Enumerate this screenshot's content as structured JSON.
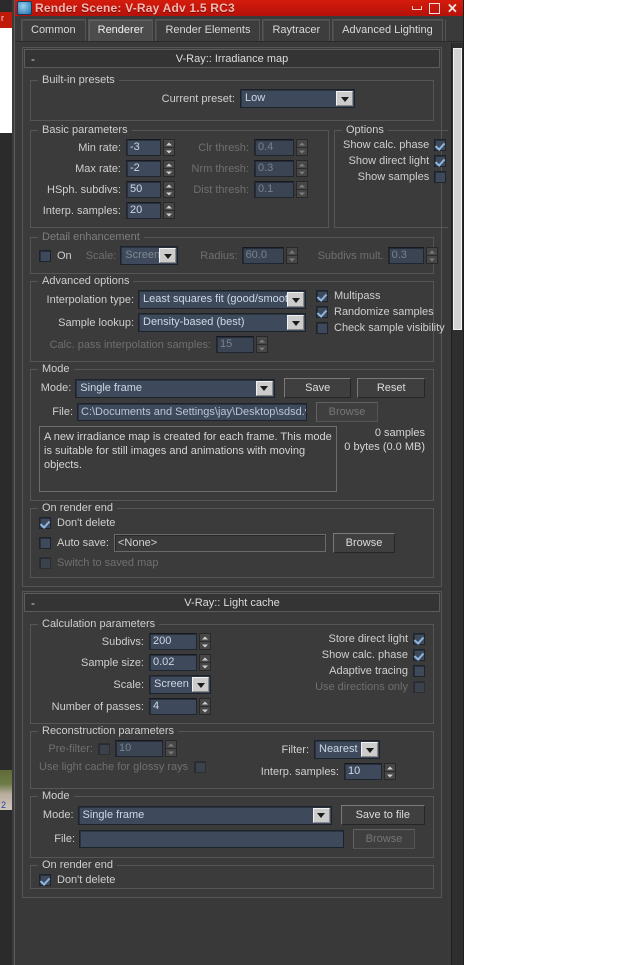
{
  "window": {
    "title": "Render Scene: V-Ray Adv 1.5 RC3",
    "app_icon": "render-scene-icon",
    "minimize": "minimize-icon",
    "maximize": "maximize-icon",
    "close": "close-icon"
  },
  "tabs": [
    {
      "label": "Common",
      "active": false
    },
    {
      "label": "Renderer",
      "active": true
    },
    {
      "label": "Render Elements",
      "active": false
    },
    {
      "label": "Raytracer",
      "active": false
    },
    {
      "label": "Advanced Lighting",
      "active": false
    }
  ],
  "irradiance_map": {
    "rollout_title": "V-Ray:: Irradiance map",
    "collapse_glyph": "-",
    "builtin_presets": {
      "legend": "Built-in presets",
      "current_preset_label": "Current preset:",
      "current_preset_value": "Low"
    },
    "basic_parameters": {
      "legend": "Basic parameters",
      "min_rate_label": "Min rate:",
      "min_rate_value": "-3",
      "max_rate_label": "Max rate:",
      "max_rate_value": "-2",
      "hsph_subdivs_label": "HSph. subdivs:",
      "hsph_subdivs_value": "50",
      "interp_samples_label": "Interp. samples:",
      "interp_samples_value": "20",
      "clr_thresh_label": "Clr thresh:",
      "clr_thresh_value": "0.4",
      "nrm_thresh_label": "Nrm thresh:",
      "nrm_thresh_value": "0.3",
      "dist_thresh_label": "Dist thresh:",
      "dist_thresh_value": "0.1"
    },
    "options": {
      "legend": "Options",
      "show_calc_phase_label": "Show calc. phase",
      "show_calc_phase_checked": true,
      "show_direct_light_label": "Show direct light",
      "show_direct_light_checked": true,
      "show_samples_label": "Show samples",
      "show_samples_checked": false
    },
    "detail_enhancement": {
      "legend": "Detail enhancement",
      "on_label": "On",
      "on_checked": false,
      "scale_label": "Scale:",
      "scale_value": "Screen",
      "radius_label": "Radius:",
      "radius_value": "60.0",
      "subdivs_mult_label": "Subdivs mult.",
      "subdivs_mult_value": "0.3"
    },
    "advanced_options": {
      "legend": "Advanced options",
      "interpolation_type_label": "Interpolation type:",
      "interpolation_type_value": "Least squares fit (good/smooth",
      "sample_lookup_label": "Sample lookup:",
      "sample_lookup_value": "Density-based (best)",
      "calc_pass_label": "Calc. pass interpolation samples:",
      "calc_pass_value": "15",
      "multipass_label": "Multipass",
      "multipass_checked": true,
      "randomize_samples_label": "Randomize samples",
      "randomize_samples_checked": true,
      "check_sample_visibility_label": "Check sample visibility",
      "check_sample_visibility_checked": false
    },
    "mode": {
      "legend": "Mode",
      "mode_label": "Mode:",
      "mode_value": "Single frame",
      "save_button": "Save",
      "reset_button": "Reset",
      "file_label": "File:",
      "file_value": "C:\\Documents and Settings\\jay\\Desktop\\sdsd.vrmap",
      "browse_button": "Browse",
      "description": "A new irradiance map is created for each frame. This mode is suitable for still images and animations with moving objects.",
      "samples_text": "0 samples",
      "bytes_text": "0 bytes (0.0 MB)"
    },
    "on_render_end": {
      "legend": "On render end",
      "dont_delete_label": "Don't delete",
      "dont_delete_checked": true,
      "auto_save_label": "Auto save:",
      "auto_save_checked": false,
      "auto_save_value": "<None>",
      "browse_button": "Browse",
      "switch_to_saved_map_label": "Switch to saved map",
      "switch_to_saved_map_checked": false
    }
  },
  "light_cache": {
    "rollout_title": "V-Ray:: Light cache",
    "collapse_glyph": "-",
    "calculation_parameters": {
      "legend": "Calculation parameters",
      "subdivs_label": "Subdivs:",
      "subdivs_value": "200",
      "sample_size_label": "Sample size:",
      "sample_size_value": "0.02",
      "scale_label": "Scale:",
      "scale_value": "Screen",
      "number_of_passes_label": "Number of passes:",
      "number_of_passes_value": "4",
      "store_direct_light_label": "Store direct light",
      "store_direct_light_checked": true,
      "show_calc_phase_label": "Show calc. phase",
      "show_calc_phase_checked": true,
      "adaptive_tracing_label": "Adaptive tracing",
      "adaptive_tracing_checked": false,
      "use_directions_only_label": "Use directions only",
      "use_directions_only_checked": false
    },
    "reconstruction_parameters": {
      "legend": "Reconstruction parameters",
      "pre_filter_label": "Pre-filter:",
      "pre_filter_checked": false,
      "pre_filter_value": "10",
      "use_light_cache_glossy_label": "Use light cache for glossy rays",
      "use_light_cache_glossy_checked": false,
      "filter_label": "Filter:",
      "filter_value": "Nearest",
      "interp_samples_label": "Interp. samples:",
      "interp_samples_value": "10"
    },
    "mode": {
      "legend": "Mode",
      "mode_label": "Mode:",
      "mode_value": "Single frame",
      "save_to_file_button": "Save to file",
      "file_label": "File:",
      "file_value": "",
      "browse_button": "Browse"
    },
    "on_render_end": {
      "legend": "On render end",
      "dont_delete_label": "Don't delete",
      "dont_delete_checked": true
    }
  },
  "background_window": {
    "title_fragment": "r",
    "number_fragment": "2"
  },
  "colors": {
    "title_bar": "#c8140a",
    "window_bg": "#3a3a3a",
    "field_bg": "#3e4a5c",
    "field_text": "#cdd8e6",
    "label_text": "#cfcfcf",
    "disabled_text": "#7d7d7d",
    "check_mark": "#8fb6e0",
    "scrollbar_thumb": "#d2d2d2"
  }
}
